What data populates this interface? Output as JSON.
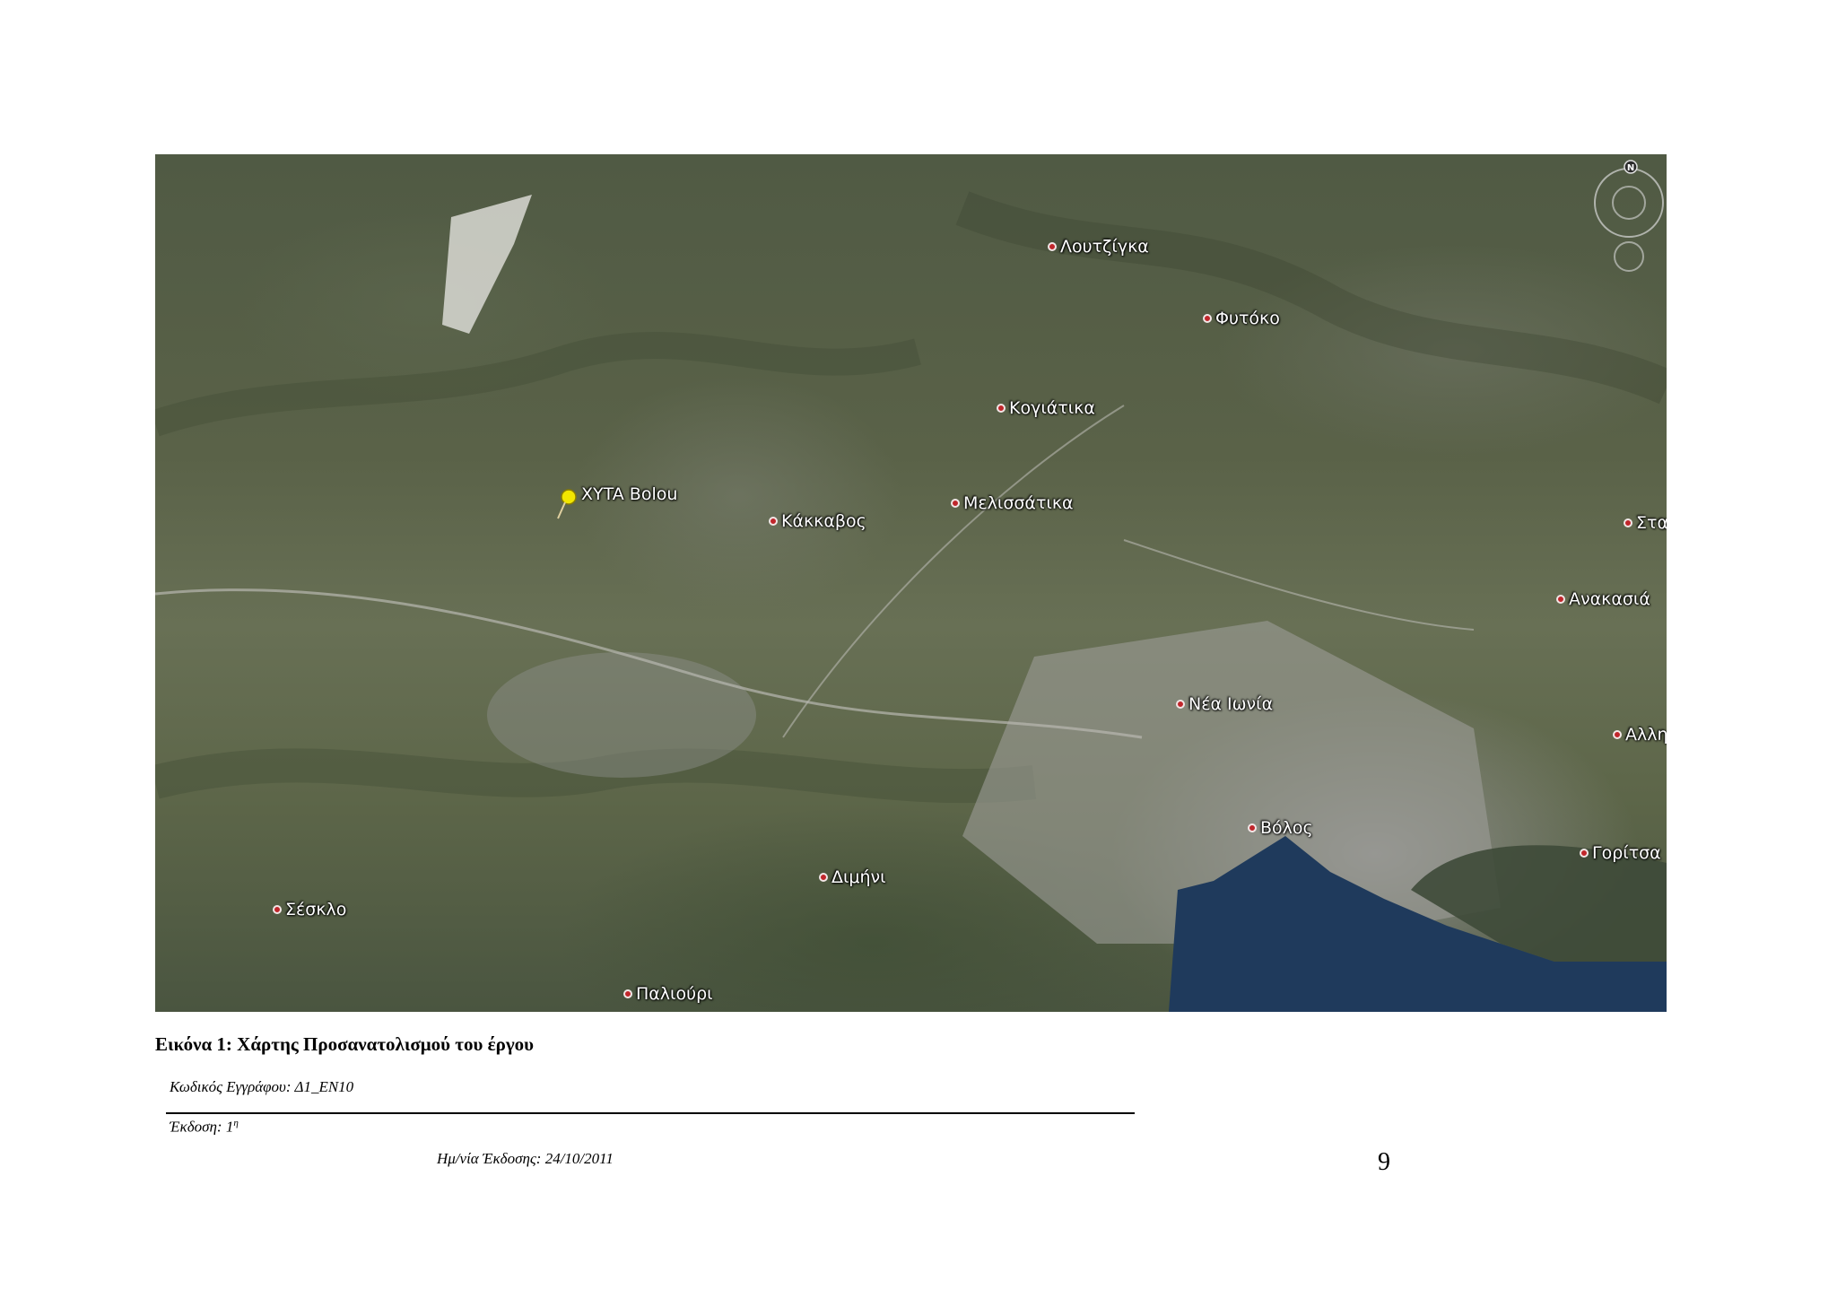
{
  "map": {
    "places": [
      {
        "id": "loutzigka",
        "label": "Λουτζίγκα"
      },
      {
        "id": "fytoko",
        "label": "Φυτόκο"
      },
      {
        "id": "kogiatika",
        "label": "Κογιάτικα"
      },
      {
        "id": "kakkavos",
        "label": "Κάκκαβος"
      },
      {
        "id": "melissatika",
        "label": "Μελισσάτικα"
      },
      {
        "id": "sta",
        "label": "Στα"
      },
      {
        "id": "anakasia",
        "label": "Ανακασιά"
      },
      {
        "id": "nea-ionia",
        "label": "Νέα Ιωνία"
      },
      {
        "id": "alli",
        "label": "Αλλη"
      },
      {
        "id": "volos",
        "label": "Βόλος"
      },
      {
        "id": "goritsa",
        "label": "Γορίτσα"
      },
      {
        "id": "dimini",
        "label": "Διμήνι"
      },
      {
        "id": "sesklo",
        "label": "Σέσκλο"
      },
      {
        "id": "paliouri",
        "label": "Παλιούρι"
      }
    ],
    "pin": {
      "label": "XYTA Bolou",
      "icon": "pushpin-icon",
      "color": "#f2e600"
    },
    "compass": {
      "letter": "N"
    },
    "colors": {
      "place_dot": "#c0262b",
      "sea": "#1f3a5c"
    }
  },
  "caption": "Εικόνα 1: Χάρτης Προσανατολισμού του έργου",
  "footer": {
    "doc_code": "Κωδικός Εγγράφου: Δ1_ΕΝ10",
    "edition": "Έκδοση: 1",
    "edition_sup": "η",
    "issue_date": "Ημ/νία Έκδοσης: 24/10/2011",
    "page_number": "9"
  }
}
